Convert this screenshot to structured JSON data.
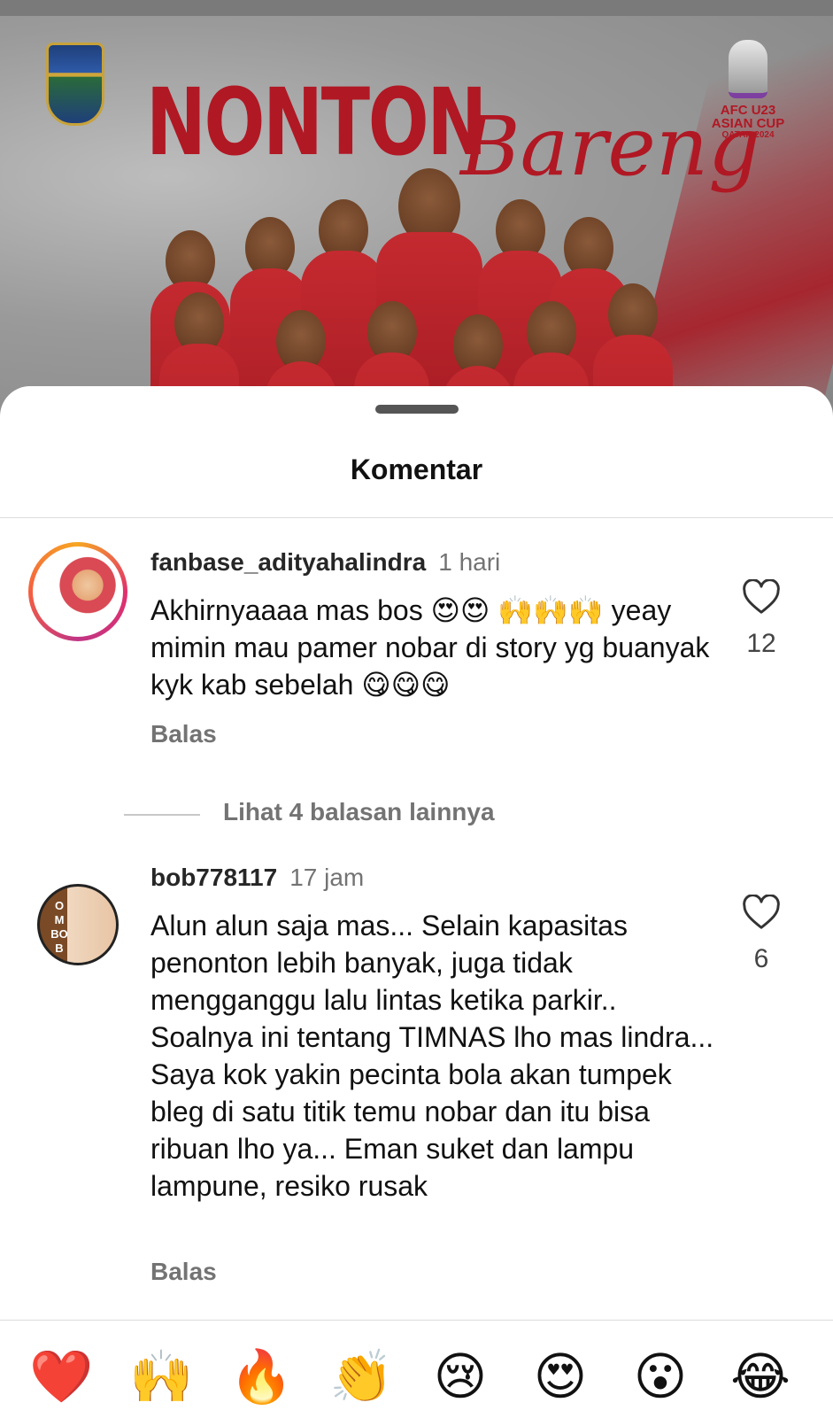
{
  "post": {
    "title_main": "NONTON",
    "title_script": "Bareng",
    "badge": {
      "line1": "AFC U23",
      "line2": "ASIAN CUP",
      "line3": "QATAR 2024"
    }
  },
  "sheet": {
    "title": "Komentar"
  },
  "comments": [
    {
      "username": "fanbase_adityahalindra",
      "time": "1 hari",
      "text": "Akhirnyaaaa mas bos 😍😍 🙌🙌🙌 yeay mimin mau pamer nobar di story yg buanyak kyk kab sebelah 😋😋😋",
      "reply_label": "Balas",
      "likes": "12",
      "more_replies": "Lihat 4 balasan lainnya"
    },
    {
      "username": "bob778117",
      "time": "17 jam",
      "avatar_letters": "OMBOB",
      "text": "Alun alun saja mas... Selain kapasitas penonton lebih banyak, juga tidak mengganggu lalu lintas ketika parkir.. Soalnya ini tentang TIMNAS lho mas lindra... Saya kok yakin pecinta bola akan tumpek bleg di satu titik temu nobar dan itu bisa ribuan lho ya... Eman suket dan lampu lampune, resiko rusak",
      "reply_label": "Balas",
      "likes": "6"
    }
  ],
  "emoji_bar": [
    "❤️",
    "🙌",
    "🔥",
    "👏",
    "😢",
    "😍",
    "😮",
    "😂"
  ],
  "colors": {
    "accent_red": "#b01824",
    "muted_text": "#737373",
    "divider": "#dcdcdc"
  }
}
